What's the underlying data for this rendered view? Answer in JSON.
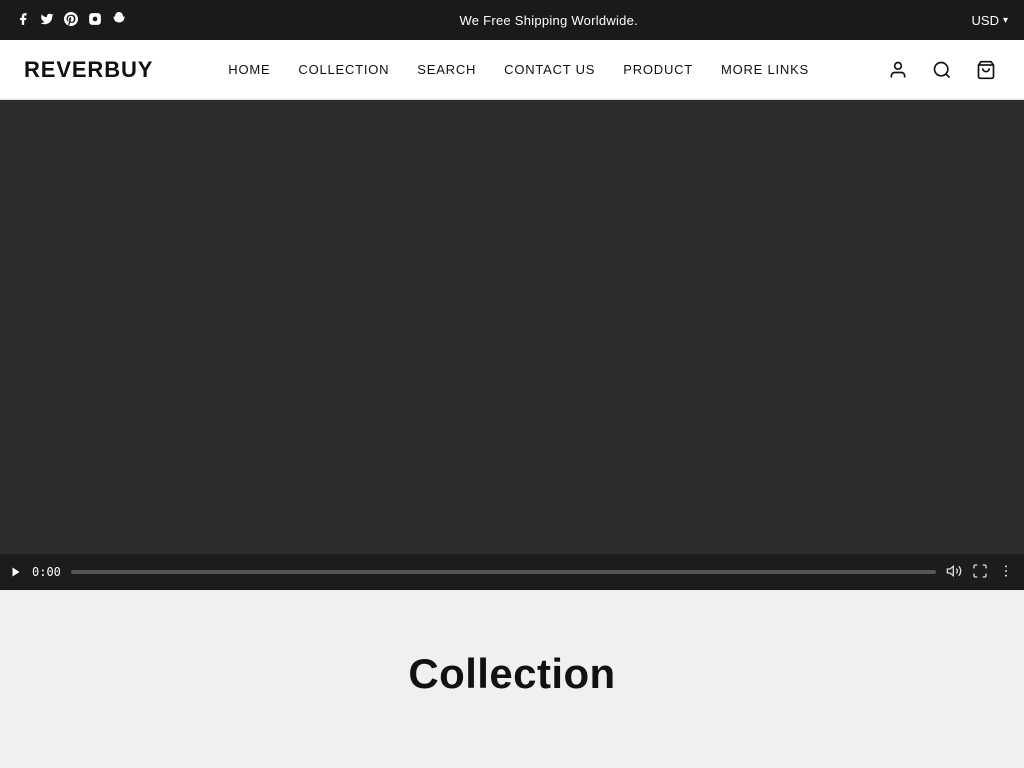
{
  "announcement": {
    "text": "We  Free Shipping Worldwide."
  },
  "currency": {
    "label": "USD",
    "chevron": "▾"
  },
  "social": {
    "icons": [
      {
        "name": "facebook",
        "symbol": "f"
      },
      {
        "name": "twitter",
        "symbol": "𝕏"
      },
      {
        "name": "pinterest",
        "symbol": "𝐏"
      },
      {
        "name": "instagram",
        "symbol": "◎"
      },
      {
        "name": "snapchat",
        "symbol": "👻"
      }
    ]
  },
  "logo": {
    "text": "REVERBUY"
  },
  "nav": {
    "items": [
      {
        "label": "HOME",
        "href": "#"
      },
      {
        "label": "COLLECTION",
        "href": "#"
      },
      {
        "label": "SEARCH",
        "href": "#"
      },
      {
        "label": "CONTACT US",
        "href": "#"
      },
      {
        "label": "PRODUCT",
        "href": "#"
      },
      {
        "label": "MORE  LINKS",
        "href": "#"
      }
    ]
  },
  "header_icons": {
    "account": "👤",
    "search": "🔍",
    "cart": "🛒"
  },
  "video": {
    "time": "0:00",
    "progress": 0
  },
  "collection": {
    "title": "Collection"
  }
}
